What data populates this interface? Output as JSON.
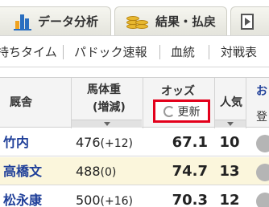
{
  "tabs": [
    {
      "label": "データ分析",
      "icon": "bar-chart-icon"
    },
    {
      "label": "結果・払戻",
      "icon": "coins-icon"
    },
    {
      "label": "",
      "icon": "video-icon"
    }
  ],
  "subnav": [
    "持ちタイム",
    "パドック速報",
    "血統",
    "対戦表"
  ],
  "table": {
    "headers": {
      "jockey": "厩舎",
      "weight_line1": "馬体重",
      "weight_line2": "(増減)",
      "odds": "オッズ",
      "refresh": "更新",
      "popularity": "人気",
      "extra_top": "お",
      "extra_bottom": "登"
    },
    "rows": [
      {
        "jockey": "竹内",
        "weight": "476",
        "diff": "(+12)",
        "odds": "67.1",
        "popularity": "10"
      },
      {
        "jockey": "高橋文",
        "weight": "488",
        "diff": "(0)",
        "odds": "74.7",
        "popularity": "13"
      },
      {
        "jockey": "松永康",
        "weight": "500",
        "diff": "(+16)",
        "odds": "70.3",
        "popularity": "12"
      }
    ]
  },
  "colors": {
    "highlight_border": "#e3001b",
    "jockey_link": "#1f3f99",
    "alt_row": "#fbf6dc"
  }
}
